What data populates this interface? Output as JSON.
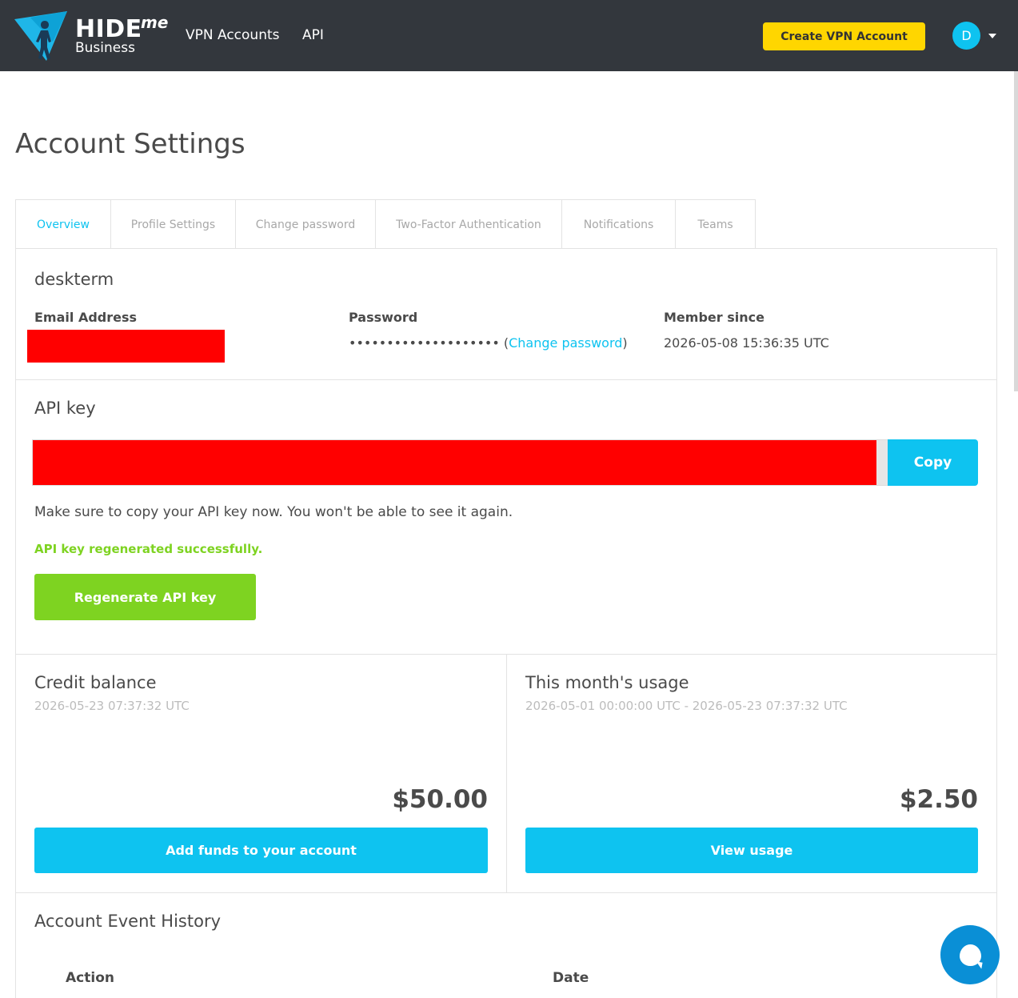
{
  "header": {
    "logo_main": "HIDE",
    "logo_me": "me",
    "logo_sub": "Business",
    "nav": [
      "VPN Accounts",
      "API"
    ],
    "create_button": "Create VPN Account",
    "avatar_letter": "D",
    "brand_color": "#0ec3f0",
    "create_button_color": "#ffd600"
  },
  "page": {
    "title": "Account Settings"
  },
  "tabs": [
    "Overview",
    "Profile Settings",
    "Change password",
    "Two-Factor Authentication",
    "Notifications",
    "Teams"
  ],
  "active_tab": "Overview",
  "overview": {
    "username": "deskterm",
    "email_label": "Email Address",
    "password_label": "Password",
    "password_masked": "•••••••••••••••••••• ",
    "paren_open": "(",
    "change_password_link": "Change password",
    "paren_close": ")",
    "member_since_label": "Member since",
    "member_since_value": "2026-05-08 15:36:35 UTC"
  },
  "api": {
    "title": "API key",
    "copy_button": "Copy",
    "note": "Make sure to copy your API key now. You won't be able to see it again.",
    "success_message": "API key regenerated successfully.",
    "regenerate_button": "Regenerate API key",
    "success_color": "#7ed321"
  },
  "credit": {
    "title": "Credit balance",
    "timestamp": "2026-05-23 07:37:32 UTC",
    "amount": "$50.00",
    "button": "Add funds to your account"
  },
  "usage": {
    "title": "This month's usage",
    "range": "2026-05-01 00:00:00 UTC - 2026-05-23 07:37:32 UTC",
    "amount": "$2.50",
    "button": "View usage"
  },
  "history": {
    "title": "Account Event History",
    "columns": [
      "Action",
      "Date"
    ]
  },
  "chat": {
    "icon": "chat-bubble-icon"
  }
}
